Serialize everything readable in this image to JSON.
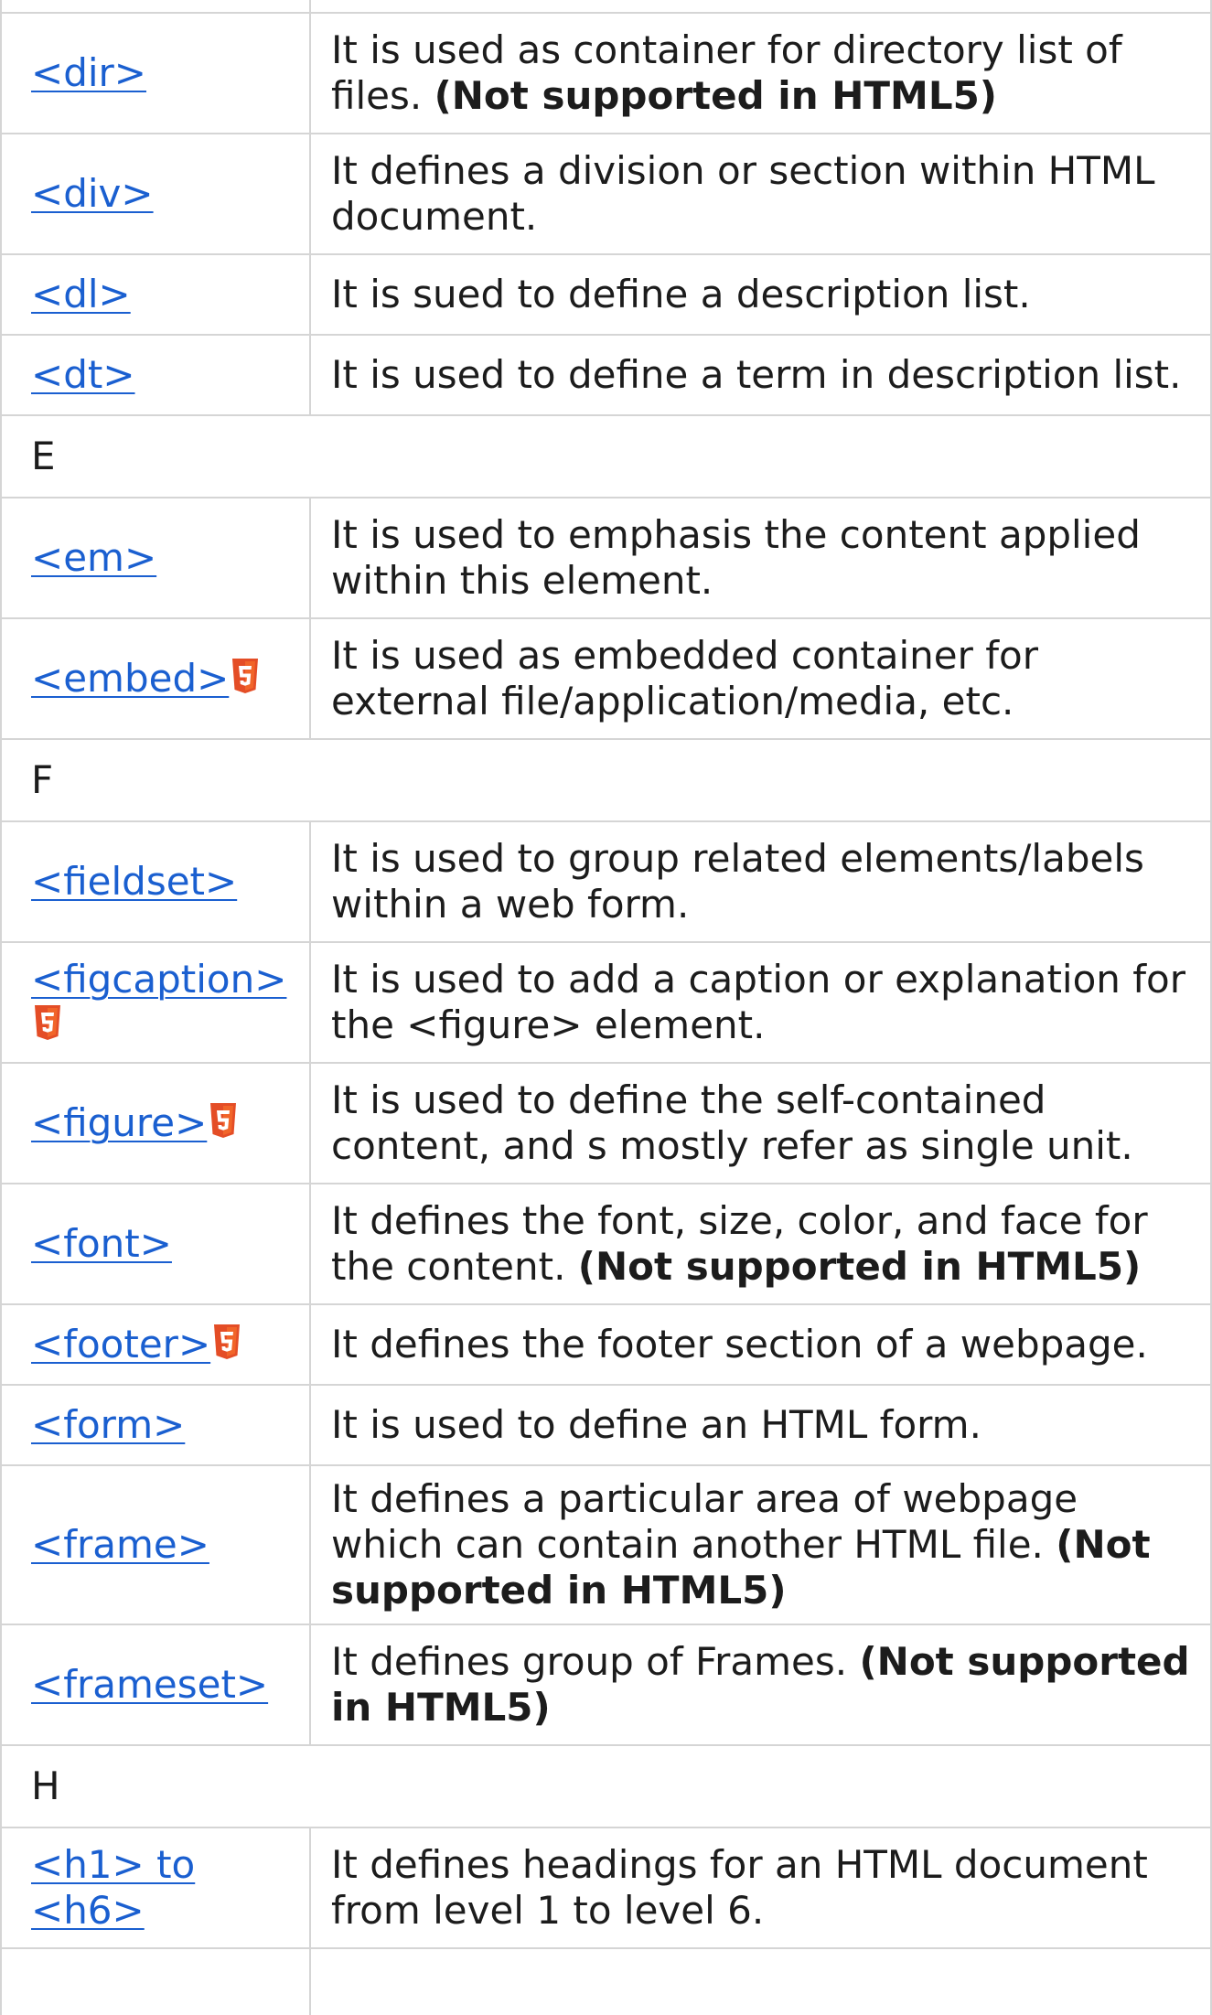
{
  "rows": [
    {
      "kind": "partial-top"
    },
    {
      "kind": "tag",
      "tag": "<dir>",
      "html5": false,
      "desc": "It is used as container for directory list of files.",
      "note": "(Not supported in HTML5)"
    },
    {
      "kind": "tag",
      "tag": "<div>",
      "html5": false,
      "desc": "It defines a division or section within HTML document.",
      "note": ""
    },
    {
      "kind": "tag",
      "tag": "<dl>",
      "html5": false,
      "desc": "It is sued to define a description list.",
      "note": ""
    },
    {
      "kind": "tag",
      "tag": "<dt>",
      "html5": false,
      "desc": "It is used to define a term in description list.",
      "note": ""
    },
    {
      "kind": "letter",
      "letter": "E"
    },
    {
      "kind": "tag",
      "tag": "<em>",
      "html5": false,
      "desc": "It is used to emphasis the content applied within this element.",
      "note": ""
    },
    {
      "kind": "tag",
      "tag": "<embed>",
      "html5": true,
      "desc": "It is used as embedded container for external file/application/media, etc.",
      "note": ""
    },
    {
      "kind": "letter",
      "letter": "F"
    },
    {
      "kind": "tag",
      "tag": "<fieldset>",
      "html5": false,
      "desc": "It is used to group related elements/labels within a web form.",
      "note": ""
    },
    {
      "kind": "tag",
      "tag": "<figcaption>",
      "html5": true,
      "desc": "It is used to add a caption or explanation for the <figure> element.",
      "note": ""
    },
    {
      "kind": "tag",
      "tag": "<figure>",
      "html5": true,
      "desc": "It is used to define the self-contained content, and s mostly refer as single unit.",
      "note": ""
    },
    {
      "kind": "tag",
      "tag": "<font>",
      "html5": false,
      "desc": "It defines the font, size, color, and face for the content.",
      "note": "(Not supported in HTML5)"
    },
    {
      "kind": "tag",
      "tag": "<footer>",
      "html5": true,
      "desc": "It defines the footer section of a webpage.",
      "note": ""
    },
    {
      "kind": "tag",
      "tag": "<form>",
      "html5": false,
      "desc": "It is used to define an HTML form.",
      "note": ""
    },
    {
      "kind": "tag",
      "tag": "<frame>",
      "html5": false,
      "desc": "It defines a particular area of webpage which can contain another HTML file.",
      "note": "(Not supported in HTML5)"
    },
    {
      "kind": "tag",
      "tag": "<frameset>",
      "html5": false,
      "desc": "It defines group of Frames.",
      "note": "(Not supported in HTML5)"
    },
    {
      "kind": "letter",
      "letter": "H"
    },
    {
      "kind": "tag",
      "tag": "<h1> to <h6>",
      "html5": false,
      "desc": "It defines headings for an HTML document from level 1 to level 6.",
      "note": ""
    },
    {
      "kind": "partial-bottom"
    }
  ],
  "colors": {
    "link": "#1a5fd0",
    "border": "#d5d5d5",
    "text": "#1c1c1c",
    "html5_badge": "#e44d26"
  },
  "icons": {
    "html5": "html5-badge-icon"
  }
}
